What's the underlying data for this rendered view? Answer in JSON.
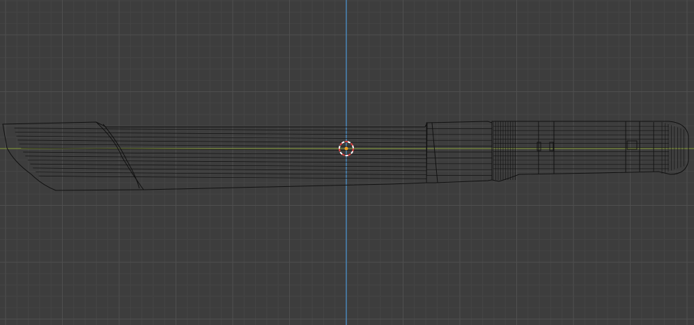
{
  "viewport": {
    "background_color": "#3d3d3d",
    "grid_minor_color": "#454545",
    "grid_major_color": "#4f4f4f",
    "x_axis_color": "#7a8a3a",
    "y_axis_color": "#4a86b8"
  },
  "object": {
    "type": "knife-mesh",
    "display": "wireframe",
    "wire_color": "#111111"
  },
  "cursor_3d": {
    "icon": "3d-cursor-icon",
    "ring_color_a": "#e04040",
    "ring_color_b": "#ffffff",
    "origin_color": "#f0a020"
  }
}
